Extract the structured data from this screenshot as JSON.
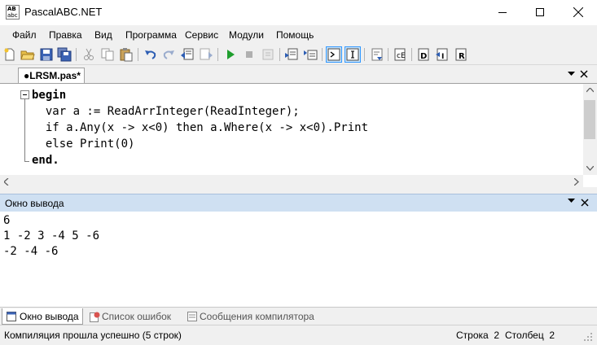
{
  "window": {
    "title": "PascalABC.NET",
    "icon_text_1": "AB",
    "icon_text_2": "abc"
  },
  "menu": {
    "items": [
      "Файл",
      "Правка",
      "Вид",
      "Программа",
      "Сервис",
      "Модули",
      "Помощь"
    ]
  },
  "toolbar": {
    "icons": [
      "new-file-icon",
      "open-file-icon",
      "save-icon",
      "save-all-icon",
      "cut-icon",
      "copy-icon",
      "paste-icon",
      "undo-icon",
      "redo-icon",
      "navigate-back-icon",
      "navigate-forward-icon",
      "run-icon",
      "stop-icon",
      "debug-icon",
      "step-icon",
      "output-window-icon",
      "input-window-icon",
      "format-icon",
      "view-icon",
      "build-icon",
      "compile-icon",
      "rebuild-icon"
    ]
  },
  "editor": {
    "tab_label": "●LRSM.pas*",
    "code_lines": [
      [
        "",
        "begin"
      ],
      [
        "  ",
        "var a := ReadArrInteger(ReadInteger);"
      ],
      [
        "  ",
        "if a.Any(x -> x<0) then a.Where(x -> x<0).Print"
      ],
      [
        "  ",
        "else Print(0)"
      ],
      [
        "",
        "end."
      ]
    ]
  },
  "output_panel": {
    "title": "Окно вывода",
    "lines": [
      "6",
      "1 -2 3 -4 5 -6",
      "-2 -4 -6"
    ]
  },
  "bottom_tabs": [
    {
      "label": "Окно вывода",
      "active": true
    },
    {
      "label": "Список ошибок",
      "active": false
    },
    {
      "label": "Сообщения компилятора",
      "active": false
    }
  ],
  "status": {
    "message": "Компиляция прошла успешно (5 строк)",
    "line": "Строка  2",
    "column": "Столбец  2"
  }
}
